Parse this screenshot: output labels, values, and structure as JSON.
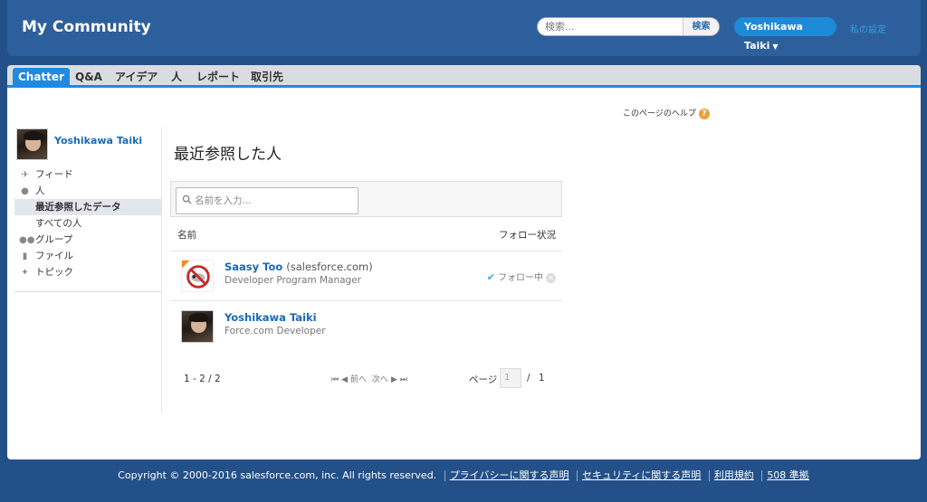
{
  "header": {
    "brand": "My Community",
    "search_placeholder": "検索...",
    "search_button": "検索",
    "user_name": "Yoshikawa Taiki",
    "my_settings": "私の設定"
  },
  "tabs": [
    "Chatter",
    "Q&A",
    "アイデア",
    "人",
    "レポート",
    "取引先"
  ],
  "help_link": "このページのヘルプ",
  "sidebar": {
    "user_name": "Yoshikawa Taiki",
    "items": [
      {
        "label": "フィード",
        "icon": "feed-icon"
      },
      {
        "label": "人",
        "icon": "person-icon"
      },
      {
        "label": "最近参照したデータ",
        "icon": ""
      },
      {
        "label": "すべての人",
        "icon": ""
      },
      {
        "label": "グループ",
        "icon": "group-icon"
      },
      {
        "label": "ファイル",
        "icon": "file-icon"
      },
      {
        "label": "トピック",
        "icon": "topic-icon"
      }
    ]
  },
  "main": {
    "title": "最近参照した人",
    "name_search_placeholder": "名前を入力...",
    "columns": {
      "name": "名前",
      "follow": "フォロー状況"
    },
    "rows": [
      {
        "name": "Saasy Too",
        "org": "(salesforce.com)",
        "title": "Developer Program Manager",
        "follow_status": "フォロー中"
      },
      {
        "name": "Yoshikawa Taiki",
        "org": "",
        "title": "Force.com Developer",
        "follow_status": ""
      }
    ],
    "pager": {
      "count": "1 - 2 / 2",
      "prev": "前へ",
      "next": "次へ",
      "page_label": "ページ",
      "page_value": "1",
      "page_total": "/ 1"
    }
  },
  "footer": {
    "copyright": "Copyright © 2000-2016 salesforce.com, inc. All rights reserved.",
    "links": [
      "プライバシーに関する声明",
      "セキュリティに関する声明",
      "利用規約",
      "508 準拠"
    ]
  }
}
